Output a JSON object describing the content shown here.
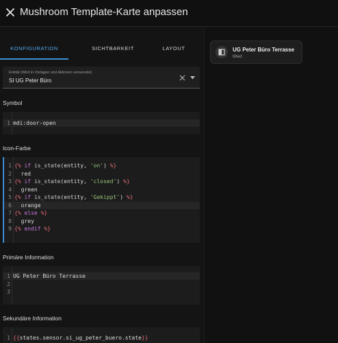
{
  "header": {
    "title": "Mushroom Template-Karte anpassen",
    "close_icon": "close-icon"
  },
  "tabs": [
    {
      "label": "KONFIGURATION",
      "active": true
    },
    {
      "label": "SICHTBARKEIT",
      "active": false
    },
    {
      "label": "LAYOUT",
      "active": false
    }
  ],
  "entity": {
    "label": "Entität (Wird in Vorlagen und Aktionen verwendet)",
    "value": "SI UG Peter Büro",
    "clear_icon": "close-icon",
    "caret_icon": "caret-down-icon"
  },
  "symbol": {
    "label": "Symbol",
    "lines": [
      {
        "n": "1",
        "text": "mdi:door-open"
      }
    ]
  },
  "icon_color": {
    "label": "Icon-Farbe",
    "lines": [
      {
        "n": "1",
        "text": "{% if is_state(entity, 'on') %}"
      },
      {
        "n": "2",
        "text": "  red"
      },
      {
        "n": "3",
        "text": "{% if is_state(entity, 'closed') %}"
      },
      {
        "n": "4",
        "text": "  green"
      },
      {
        "n": "5",
        "text": "{% if is_state(entity, 'Gekippt') %}"
      },
      {
        "n": "6",
        "text": "  orange"
      },
      {
        "n": "7",
        "text": "{% else %}"
      },
      {
        "n": "8",
        "text": "  grey"
      },
      {
        "n": "9",
        "text": "{% endif %}"
      }
    ]
  },
  "primary": {
    "label": "Primäre Information",
    "lines": [
      {
        "n": "1",
        "text": "UG Peter Büro Terrasse"
      },
      {
        "n": "2",
        "text": ""
      },
      {
        "n": "3",
        "text": ""
      }
    ]
  },
  "secondary": {
    "label": "Sekundäre Information",
    "lines": [
      {
        "n": "1",
        "text": "{{states.sensor.si_ug_peter_buero.state}}"
      }
    ]
  },
  "preview": {
    "icon": "door-window-icon",
    "primary": "UG Peter Büro Terrasse",
    "secondary": "tilted"
  },
  "colors": {
    "accent": "#3d8fd6",
    "background": "#111111",
    "editor": "#1c1c1c",
    "delimiter": "#e06c75",
    "keyword": "#c678dd",
    "string": "#98c379"
  }
}
